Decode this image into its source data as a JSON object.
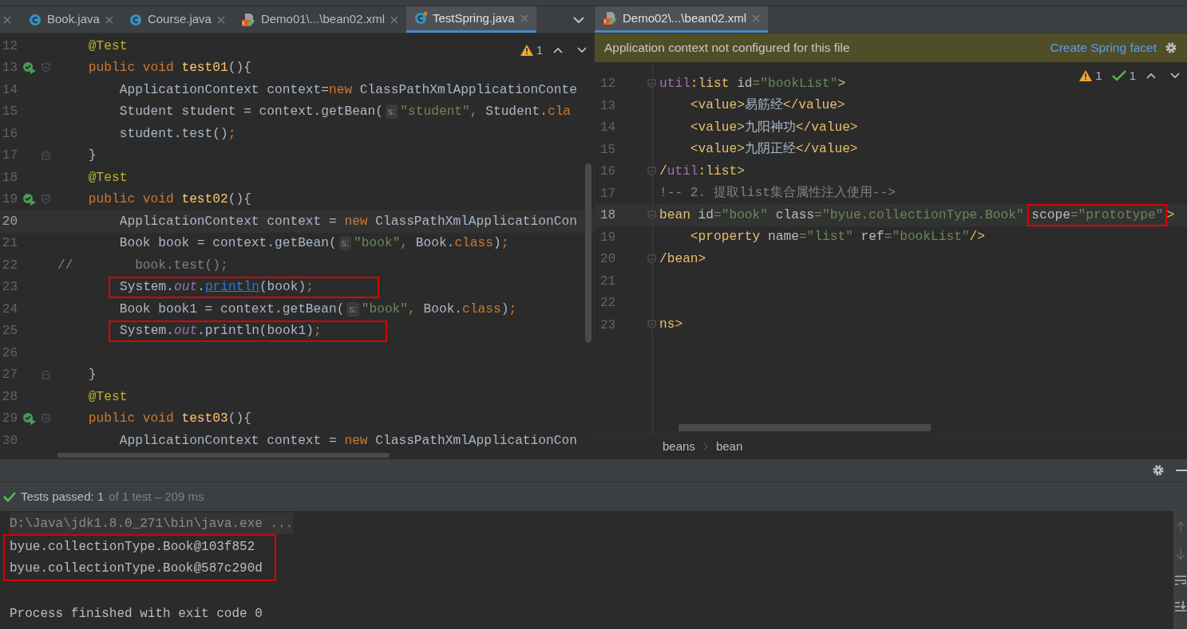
{
  "left_editor": {
    "tabs": [
      {
        "label": "Book.java",
        "kind": "java",
        "selected": false
      },
      {
        "label": "Course.java",
        "kind": "java",
        "selected": false
      },
      {
        "label": "Demo01\\...\\bean02.xml",
        "kind": "xml",
        "selected": false
      },
      {
        "label": "TestSpring.java",
        "kind": "test",
        "selected": true
      }
    ],
    "inspections": [
      {
        "kind": "warning",
        "text": "1"
      }
    ],
    "lines": [
      {
        "number": "12",
        "current": false,
        "run": false,
        "fold": false,
        "tokens": [
          {
            "kind": "ann",
            "text": "    @Test"
          }
        ]
      },
      {
        "number": "13",
        "current": false,
        "run": true,
        "fold": true,
        "tokens": [
          {
            "kind": "kw",
            "text": "    public void "
          },
          {
            "kind": "fn",
            "text": "test01"
          },
          {
            "kind": "plain",
            "text": "(){"
          }
        ]
      },
      {
        "number": "14",
        "current": false,
        "run": false,
        "fold": false,
        "tokens": [
          {
            "kind": "plain",
            "text": "        ApplicationContext context="
          },
          {
            "kind": "kw",
            "text": "new "
          },
          {
            "kind": "plain",
            "text": "ClassPathXmlApplicationConte"
          }
        ]
      },
      {
        "number": "15",
        "current": false,
        "run": false,
        "fold": false,
        "tokens": [
          {
            "kind": "plain",
            "text": "        Student student = context.getBean("
          },
          {
            "kind": "hint",
            "text": "s:"
          },
          {
            "kind": "str",
            "text": "\"student\""
          },
          {
            "kind": "kw",
            "text": ", "
          },
          {
            "kind": "plain",
            "text": "Student."
          },
          {
            "kind": "kw",
            "text": "cla"
          }
        ]
      },
      {
        "number": "16",
        "current": false,
        "run": false,
        "fold": false,
        "tokens": [
          {
            "kind": "plain",
            "text": "        student.test()"
          },
          {
            "kind": "kw",
            "text": ";"
          }
        ]
      },
      {
        "number": "17",
        "current": false,
        "run": false,
        "fold": true,
        "tokens": [
          {
            "kind": "plain",
            "text": "    }"
          }
        ]
      },
      {
        "number": "18",
        "current": false,
        "run": false,
        "fold": false,
        "tokens": [
          {
            "kind": "ann",
            "text": "    @Test"
          }
        ]
      },
      {
        "number": "19",
        "current": false,
        "run": true,
        "fold": true,
        "tokens": [
          {
            "kind": "kw",
            "text": "    public void "
          },
          {
            "kind": "fn",
            "text": "test02"
          },
          {
            "kind": "plain",
            "text": "(){"
          }
        ]
      },
      {
        "number": "20",
        "current": true,
        "run": false,
        "fold": false,
        "tokens": [
          {
            "kind": "plain",
            "text": "        ApplicationContext context = "
          },
          {
            "kind": "kw",
            "text": "new "
          },
          {
            "kind": "plain",
            "text": "ClassPathXmlApplicationCon"
          }
        ]
      },
      {
        "number": "21",
        "current": false,
        "run": false,
        "fold": false,
        "tokens": [
          {
            "kind": "plain",
            "text": "        Book book = context.getBean("
          },
          {
            "kind": "hint",
            "text": "s:"
          },
          {
            "kind": "str",
            "text": "\"book\""
          },
          {
            "kind": "kw",
            "text": ", "
          },
          {
            "kind": "plain",
            "text": "Book."
          },
          {
            "kind": "kw",
            "text": "class"
          },
          {
            "kind": "plain",
            "text": ")"
          },
          {
            "kind": "kw",
            "text": ";"
          }
        ]
      },
      {
        "number": "22",
        "current": false,
        "run": false,
        "fold": false,
        "tokens": [
          {
            "kind": "comment",
            "text": "//        book.test();"
          }
        ]
      },
      {
        "number": "23",
        "current": false,
        "run": false,
        "fold": false,
        "tokens": [
          {
            "kind": "box",
            "tokens": [
              {
                "kind": "plain",
                "text": "System."
              },
              {
                "kind": "field",
                "text": "out"
              },
              {
                "kind": "plain",
                "text": "."
              },
              {
                "kind": "link",
                "text": "println"
              },
              {
                "kind": "plain",
                "text": "(book)"
              },
              {
                "kind": "kw",
                "text": ";"
              }
            ]
          }
        ]
      },
      {
        "number": "24",
        "current": false,
        "run": false,
        "fold": false,
        "tokens": [
          {
            "kind": "plain",
            "text": "        Book book1 = context.getBean("
          },
          {
            "kind": "hint",
            "text": "s:"
          },
          {
            "kind": "str",
            "text": "\"book\""
          },
          {
            "kind": "kw",
            "text": ", "
          },
          {
            "kind": "plain",
            "text": "Book."
          },
          {
            "kind": "kw",
            "text": "class"
          },
          {
            "kind": "plain",
            "text": ")"
          },
          {
            "kind": "kw",
            "text": ";"
          }
        ]
      },
      {
        "number": "25",
        "current": false,
        "run": false,
        "fold": false,
        "tokens": [
          {
            "kind": "box",
            "tokens": [
              {
                "kind": "plain",
                "text": "System."
              },
              {
                "kind": "field",
                "text": "out"
              },
              {
                "kind": "plain",
                "text": ".println(book1)"
              },
              {
                "kind": "kw",
                "text": ";"
              }
            ]
          }
        ]
      },
      {
        "number": "26",
        "current": false,
        "run": false,
        "fold": false
      },
      {
        "number": "27",
        "current": false,
        "run": false,
        "fold": true,
        "tokens": [
          {
            "kind": "plain",
            "text": "    }"
          }
        ]
      },
      {
        "number": "28",
        "current": false,
        "run": false,
        "fold": false,
        "tokens": [
          {
            "kind": "ann",
            "text": "    @Test"
          }
        ]
      },
      {
        "number": "29",
        "current": false,
        "run": true,
        "fold": true,
        "tokens": [
          {
            "kind": "kw",
            "text": "    public void "
          },
          {
            "kind": "fn",
            "text": "test03"
          },
          {
            "kind": "plain",
            "text": "(){"
          }
        ]
      },
      {
        "number": "30",
        "current": false,
        "run": false,
        "fold": false,
        "tokens": [
          {
            "kind": "plain",
            "text": "        ApplicationContext context = "
          },
          {
            "kind": "kw",
            "text": "new "
          },
          {
            "kind": "plain",
            "text": "ClassPathXmlApplicationCon"
          }
        ]
      }
    ]
  },
  "right_editor": {
    "tabs": [
      {
        "label": "Demo02\\...\\bean02.xml",
        "kind": "xml",
        "selected": true
      }
    ],
    "banner": {
      "message": "Application context not configured for this file",
      "action": "Create Spring facet"
    },
    "inspections": [
      {
        "kind": "warning",
        "text": "1"
      },
      {
        "kind": "ok",
        "text": "1"
      }
    ],
    "lines": [
      {
        "number": "12",
        "current": false,
        "fold": true,
        "tokens": [
          {
            "kind": "ns",
            "text": "util"
          },
          {
            "kind": "tag",
            "text": ":list"
          },
          {
            "kind": "attr",
            "text": " id"
          },
          {
            "kind": "val",
            "text": "=\"bookList\""
          },
          {
            "kind": "tag",
            "text": ">"
          }
        ]
      },
      {
        "number": "13",
        "current": false,
        "fold": false,
        "tokens": [
          {
            "kind": "tag",
            "text": "    <value>"
          },
          {
            "kind": "plain",
            "text": "易筋经"
          },
          {
            "kind": "tag",
            "text": "</value>"
          }
        ]
      },
      {
        "number": "14",
        "current": false,
        "fold": false,
        "tokens": [
          {
            "kind": "tag",
            "text": "    <value>"
          },
          {
            "kind": "plain",
            "text": "九阳神功"
          },
          {
            "kind": "tag",
            "text": "</value>"
          }
        ]
      },
      {
        "number": "15",
        "current": false,
        "fold": false,
        "tokens": [
          {
            "kind": "tag",
            "text": "    <value>"
          },
          {
            "kind": "plain",
            "text": "九阴正经"
          },
          {
            "kind": "tag",
            "text": "</value>"
          }
        ]
      },
      {
        "number": "16",
        "current": false,
        "fold": true,
        "tokens": [
          {
            "kind": "tag",
            "text": "/"
          },
          {
            "kind": "ns",
            "text": "util"
          },
          {
            "kind": "tag",
            "text": ":list>"
          }
        ]
      },
      {
        "number": "17",
        "current": false,
        "fold": false,
        "tokens": [
          {
            "kind": "comment",
            "text": "!-- 2. 提取list集合属性注入使用-->"
          }
        ]
      },
      {
        "number": "18",
        "current": true,
        "fold": true,
        "tokens": [
          {
            "kind": "tag",
            "text": "bean"
          },
          {
            "kind": "attr",
            "text": " id"
          },
          {
            "kind": "val",
            "text": "=\"book\""
          },
          {
            "kind": "attr",
            "text": " class"
          },
          {
            "kind": "val",
            "text": "=\"byue.collectionType.Book\" "
          },
          {
            "kind": "box",
            "tokens": [
              {
                "kind": "attr",
                "text": "scope"
              },
              {
                "kind": "val",
                "text": "=\"prototype\""
              }
            ]
          },
          {
            "kind": "tag",
            "text": ">"
          }
        ]
      },
      {
        "number": "19",
        "current": false,
        "fold": false,
        "tokens": [
          {
            "kind": "tag",
            "text": "    <property"
          },
          {
            "kind": "attr",
            "text": " name"
          },
          {
            "kind": "val",
            "text": "=\"list\""
          },
          {
            "kind": "attr",
            "text": " ref"
          },
          {
            "kind": "val",
            "text": "=\"bookList\""
          },
          {
            "kind": "tag",
            "text": "/>"
          }
        ]
      },
      {
        "number": "20",
        "current": false,
        "fold": true,
        "tokens": [
          {
            "kind": "tag",
            "text": "/bean>"
          }
        ]
      },
      {
        "number": "21",
        "current": false,
        "fold": false
      },
      {
        "number": "22",
        "current": false,
        "fold": false
      },
      {
        "number": "23",
        "current": false,
        "fold": true,
        "tokens": [
          {
            "kind": "tag",
            "text": "ns>"
          }
        ]
      }
    ],
    "breadcrumbs": [
      "beans",
      "bean"
    ]
  },
  "run_panel": {
    "status": {
      "passed": true,
      "summary": "Tests passed: 1",
      "detail": "of 1 test – 209 ms"
    },
    "output": [
      {
        "text": "D:\\Java\\jdk1.8.0_271\\bin\\java.exe ...",
        "kind": "command",
        "boxed": false
      },
      {
        "text": "byue.collectionType.Book@103f852",
        "kind": "stdout",
        "boxed": true
      },
      {
        "text": "byue.collectionType.Book@587c290d",
        "kind": "stdout",
        "boxed": true
      },
      {
        "kind": "blank",
        "boxed": false
      },
      {
        "text": "Process finished with exit code 0",
        "kind": "stdout",
        "boxed": false
      }
    ]
  }
}
